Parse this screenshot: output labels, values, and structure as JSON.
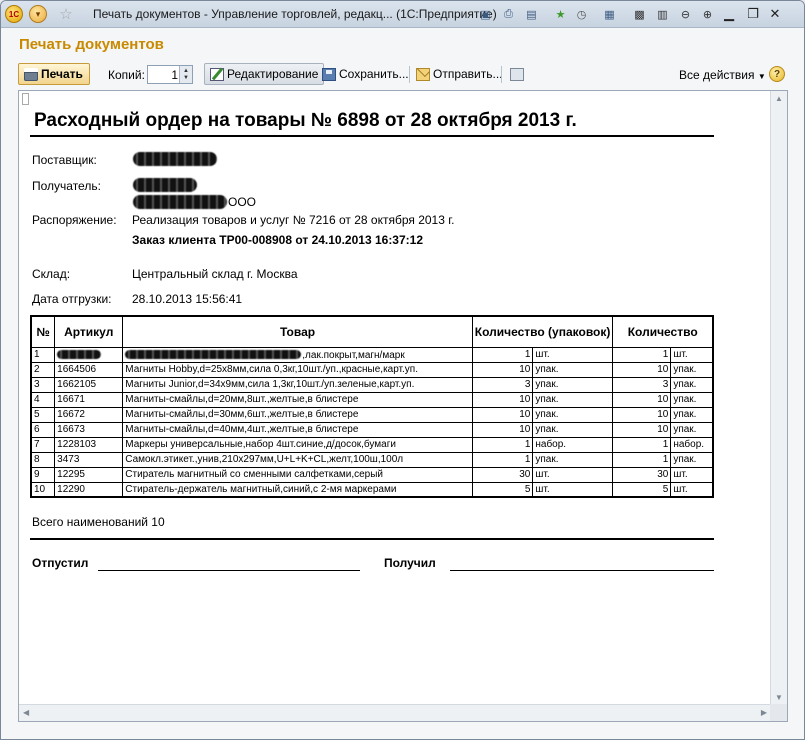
{
  "window": {
    "title": "Печать документов - Управление торговлей, редакц...   (1С:Предприятие)",
    "logo_text": "1С",
    "controls": {
      "minimize": "▁",
      "restore": "❐",
      "close": "✕"
    }
  },
  "form": {
    "title": "Печать документов"
  },
  "toolbar": {
    "print_label": "Печать",
    "copies_label": "Копий:",
    "copies_value": "1",
    "edit_label": "Редактирование",
    "save_label": "Сохранить...",
    "send_label": "Отправить...",
    "all_actions_label": "Все действия",
    "help_label": "?"
  },
  "document": {
    "title": "Расходный ордер на товары № 6898 от 28 октября 2013 г.",
    "supplier_label": "Поставщик:",
    "recipient_label": "Получатель:",
    "recipient_suffix": "ООО",
    "order_label": "Распоряжение:",
    "order_value": "Реализация товаров и услуг № 7216 от 28 октября 2013 г.",
    "client_order": "Заказ клиента ТР00-008908 от 24.10.2013 16:37:12",
    "warehouse_label": "Склад:",
    "warehouse_value": "Центральный склад г. Москва",
    "ship_date_label": "Дата отгрузки:",
    "ship_date_value": "28.10.2013 15:56:41",
    "table": {
      "headers": [
        "№",
        "Артикул",
        "Товар",
        "Количество (упаковок)",
        "Количество"
      ],
      "rows": [
        {
          "n": "1",
          "sku": "",
          "name": ",лак.покрыт,магн/марк",
          "qty_pack": "1",
          "unit_pack": "шт.",
          "qty": "1",
          "unit": "шт."
        },
        {
          "n": "2",
          "sku": "1664506",
          "name": "Магниты Hobby,d=25x8мм,сила 0,3кг,10шт./уп.,красные,карт.уп.",
          "qty_pack": "10",
          "unit_pack": "упак.",
          "qty": "10",
          "unit": "упак."
        },
        {
          "n": "3",
          "sku": "1662105",
          "name": "Магниты Junior,d=34x9мм,сила 1,3кг,10шт./уп.зеленые,карт.уп.",
          "qty_pack": "3",
          "unit_pack": "упак.",
          "qty": "3",
          "unit": "упак."
        },
        {
          "n": "4",
          "sku": "16671",
          "name": "Магниты-смайлы,d=20мм,8шт.,желтые,в блистере",
          "qty_pack": "10",
          "unit_pack": "упак.",
          "qty": "10",
          "unit": "упак."
        },
        {
          "n": "5",
          "sku": "16672",
          "name": "Магниты-смайлы,d=30мм,6шт.,желтые,в блистере",
          "qty_pack": "10",
          "unit_pack": "упак.",
          "qty": "10",
          "unit": "упак."
        },
        {
          "n": "6",
          "sku": "16673",
          "name": "Магниты-смайлы,d=40мм,4шт.,желтые,в блистере",
          "qty_pack": "10",
          "unit_pack": "упак.",
          "qty": "10",
          "unit": "упак."
        },
        {
          "n": "7",
          "sku": "1228103",
          "name": "Маркеры универсальные,набор 4шт.синие,д/досок,бумаги",
          "qty_pack": "1",
          "unit_pack": "набор.",
          "qty": "1",
          "unit": "набор."
        },
        {
          "n": "8",
          "sku": "3473",
          "name": "Самокл.этикет.,унив,210x297мм,U+L+K+CL,желт,100ш,100л",
          "qty_pack": "1",
          "unit_pack": "упак.",
          "qty": "1",
          "unit": "упак."
        },
        {
          "n": "9",
          "sku": "12295",
          "name": "Стиратель магнитный со сменными салфетками,серый",
          "qty_pack": "30",
          "unit_pack": "шт.",
          "qty": "30",
          "unit": "шт."
        },
        {
          "n": "10",
          "sku": "12290",
          "name": "Стиратель-держатель магнитный,синий,с 2-мя маркерами",
          "qty_pack": "5",
          "unit_pack": "шт.",
          "qty": "5",
          "unit": "шт."
        }
      ]
    },
    "total_text": "Всего наименований 10",
    "released_label": "Отпустил",
    "received_label": "Получил"
  }
}
